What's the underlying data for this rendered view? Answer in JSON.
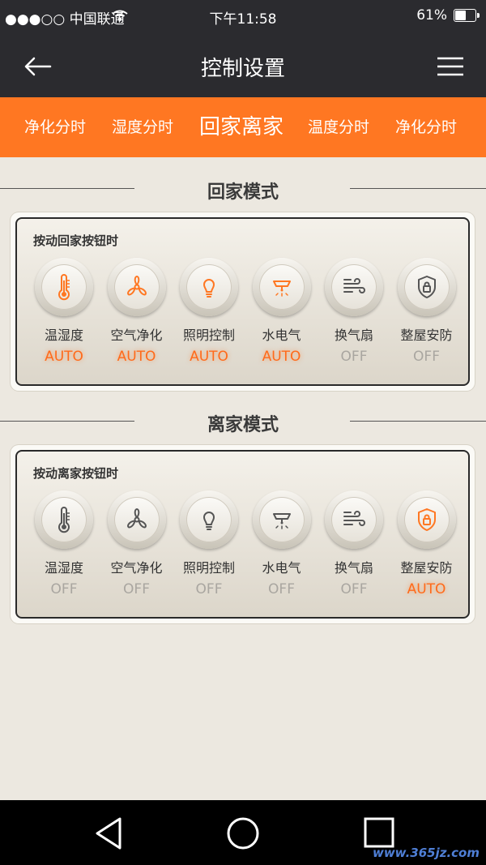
{
  "status": {
    "carrier": "●●●○○ 中国联通",
    "time": "下午11:58",
    "battery": "61%",
    "battery_level": 0.61
  },
  "nav": {
    "title": "控制设置"
  },
  "tabs": [
    "净化分时",
    "湿度分时",
    "回家离家",
    "温度分时",
    "净化分时"
  ],
  "home": {
    "section_title": "回家模式",
    "card_label": "按动回家按钮时",
    "items": [
      {
        "label": "温湿度",
        "state": "AUTO",
        "icon": "thermometer-icon"
      },
      {
        "label": "空气净化",
        "state": "AUTO",
        "icon": "fan-icon"
      },
      {
        "label": "照明控制",
        "state": "AUTO",
        "icon": "bulb-icon"
      },
      {
        "label": "水电气",
        "state": "AUTO",
        "icon": "valve-icon"
      },
      {
        "label": "换气扇",
        "state": "OFF",
        "icon": "wind-icon"
      },
      {
        "label": "整屋安防",
        "state": "OFF",
        "icon": "shield-lock-icon"
      }
    ]
  },
  "away": {
    "section_title": "离家模式",
    "card_label": "按动离家按钮时",
    "items": [
      {
        "label": "温湿度",
        "state": "OFF",
        "icon": "thermometer-icon"
      },
      {
        "label": "空气净化",
        "state": "OFF",
        "icon": "fan-icon"
      },
      {
        "label": "照明控制",
        "state": "OFF",
        "icon": "bulb-icon"
      },
      {
        "label": "水电气",
        "state": "OFF",
        "icon": "valve-icon"
      },
      {
        "label": "换气扇",
        "state": "OFF",
        "icon": "wind-icon"
      },
      {
        "label": "整屋安防",
        "state": "AUTO",
        "icon": "shield-lock-icon"
      }
    ]
  },
  "colors": {
    "accent": "#ff7722",
    "dark": "#2b2b2f",
    "off_icon": "#555555"
  },
  "watermark": "www.365jz.com"
}
